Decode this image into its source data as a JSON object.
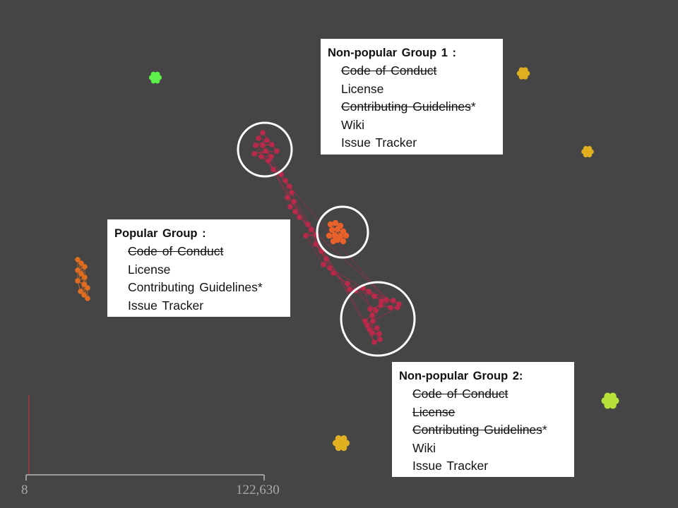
{
  "groups": {
    "popular": {
      "title": "Popular  Group :",
      "items": [
        {
          "text": "Code of Conduct",
          "struck": true,
          "mark": ""
        },
        {
          "text": "License",
          "struck": false,
          "mark": ""
        },
        {
          "text": "Contributing Guidelines",
          "struck": false,
          "mark": "*"
        },
        {
          "text": "Issue Tracker",
          "struck": false,
          "mark": ""
        }
      ]
    },
    "non_popular_1": {
      "title": "Non-popular  Group 1 :",
      "items": [
        {
          "text": "Code of Conduct",
          "struck": true,
          "mark": ""
        },
        {
          "text": "License",
          "struck": false,
          "mark": ""
        },
        {
          "text": "Contributing Guidelines",
          "struck": true,
          "mark": "*"
        },
        {
          "text": "Wiki",
          "struck": false,
          "mark": ""
        },
        {
          "text": "Issue Tracker",
          "struck": false,
          "mark": ""
        }
      ]
    },
    "non_popular_2": {
      "title": "Non-popular  Group 2:",
      "items": [
        {
          "text": "Code of Conduct",
          "struck": true,
          "mark": ""
        },
        {
          "text": "License",
          "struck": true,
          "mark": ""
        },
        {
          "text": "Contributing Guidelines",
          "struck": true,
          "mark": "*"
        },
        {
          "text": "Wiki",
          "struck": false,
          "mark": ""
        },
        {
          "text": "Issue Tracker",
          "struck": false,
          "mark": ""
        }
      ]
    }
  },
  "scale": {
    "min_label": "8",
    "max_label": "122,630"
  },
  "colors": {
    "background": "#454545",
    "main_network": "#b8294a",
    "popular_core": "#e8602a",
    "orange_cluster": "#e06d1f",
    "green_cluster": "#5ef04a",
    "lime_cluster": "#b6e03a",
    "yellow_cluster": "#e0b020",
    "highlight_ring": "#ffffff",
    "scale_line": "#9c9c9c",
    "scale_marker": "#a33a3a"
  }
}
